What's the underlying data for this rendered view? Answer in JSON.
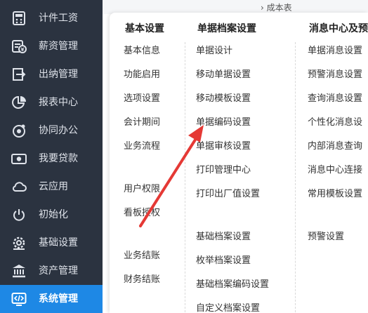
{
  "sidebar": {
    "items": [
      {
        "label": "计件工资",
        "icon": "wage-calculator-icon"
      },
      {
        "label": "薪资管理",
        "icon": "salary-icon"
      },
      {
        "label": "出纳管理",
        "icon": "cashier-export-icon"
      },
      {
        "label": "报表中心",
        "icon": "pie-chart-icon"
      },
      {
        "label": "协同办公",
        "icon": "collaboration-icon"
      },
      {
        "label": "我要贷款",
        "icon": "cash-icon"
      },
      {
        "label": "云应用",
        "icon": "cloud-icon"
      },
      {
        "label": "初始化",
        "icon": "power-icon"
      },
      {
        "label": "基础设置",
        "icon": "settings-icon"
      },
      {
        "label": "资产管理",
        "icon": "bank-icon"
      },
      {
        "label": "系统管理",
        "icon": "system-code-icon",
        "active": true
      }
    ]
  },
  "background": {
    "fragment": "› 成本表"
  },
  "menu": {
    "columns": [
      {
        "title": "基本设置",
        "items": [
          "基本信息",
          "功能启用",
          "选项设置",
          "会计期间",
          "业务流程",
          "用户权限",
          "看板授权",
          "业务结账",
          "财务结账"
        ]
      },
      {
        "title": "单据档案设置",
        "items": [
          "单据设计",
          "移动单据设置",
          "移动模板设置",
          "单据编码设置",
          "单据审核设置",
          "打印管理中心",
          "打印出厂值设置",
          "基础档案设置",
          "枚举档案设置",
          "基础档案编码设置",
          "自定义档案设置"
        ]
      },
      {
        "title": "消息中心及预",
        "items": [
          "单据消息设置",
          "预警消息设置",
          "查询消息设置",
          "个性化消息设",
          "内部消息查询",
          "消息中心连接",
          "常用模板设置",
          "预警设置"
        ]
      }
    ]
  },
  "colors": {
    "sidebar_bg": "#2b3340",
    "active_bg": "#1e88e5",
    "arrow": "#e53935"
  }
}
